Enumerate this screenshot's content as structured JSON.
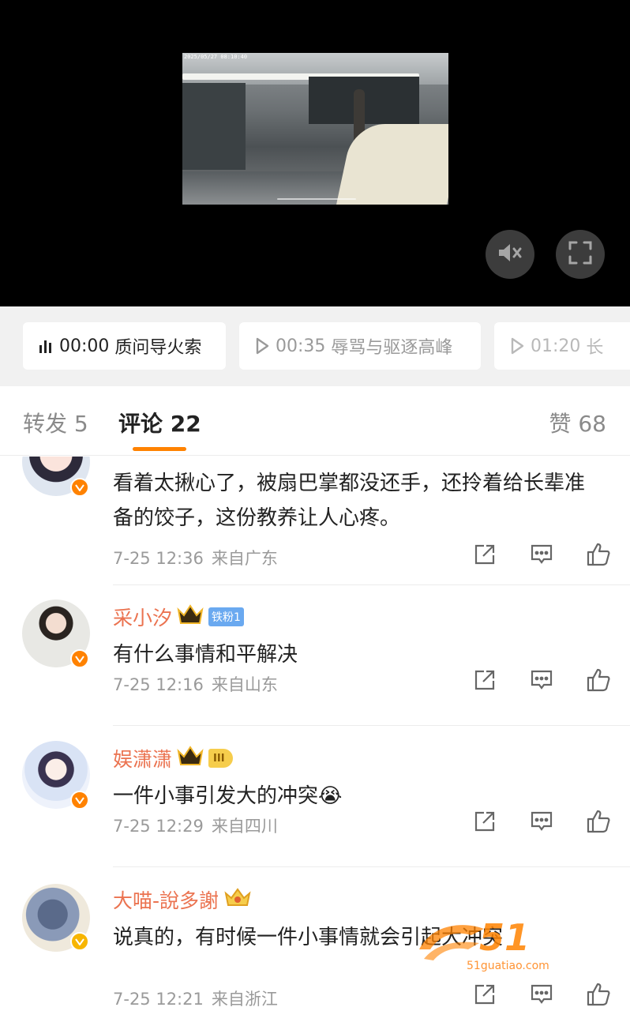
{
  "video": {
    "timestamp": "2025/05/27 08:10:40",
    "mute_icon": "speaker-muted-icon",
    "fullscreen_icon": "fullscreen-icon"
  },
  "chapters": [
    {
      "time": "00:00",
      "title": "质问导火索",
      "icon": "audio-bars-icon",
      "active": true
    },
    {
      "time": "00:35",
      "title": "辱骂与驱逐高峰",
      "icon": "play-icon",
      "active": false
    },
    {
      "time": "01:20",
      "title": "长",
      "icon": "play-icon",
      "active": false
    }
  ],
  "tabs": {
    "repost": "转发 5",
    "comments": "评论 22",
    "likes": "赞 68"
  },
  "comments": [
    {
      "username": "",
      "text": "看着太揪心了，被扇巴掌都没还手，还拎着给长辈准备的饺子，这份教养让人心疼。",
      "date": "7-25 12:36",
      "location": "来自广东"
    },
    {
      "username": "采小汐",
      "fan_badge": "铁粉1",
      "text": "有什么事情和平解决",
      "date": "7-25 12:16",
      "location": "来自山东"
    },
    {
      "username": "娱潇潇",
      "level_badge": "III",
      "text": "一件小事引发大的冲突😭",
      "date": "7-25 12:29",
      "location": "来自四川"
    },
    {
      "username": "大喵-說多謝",
      "text": "说真的，有时候一件小事情就会引起大冲突",
      "date": "7-25 12:21",
      "location": "来自浙江"
    }
  ],
  "watermark": {
    "number": "51",
    "url": "51guatiao.com"
  },
  "colors": {
    "accent": "#ff8200",
    "username": "#eb7350",
    "chip_background": "#f1f1f1"
  }
}
